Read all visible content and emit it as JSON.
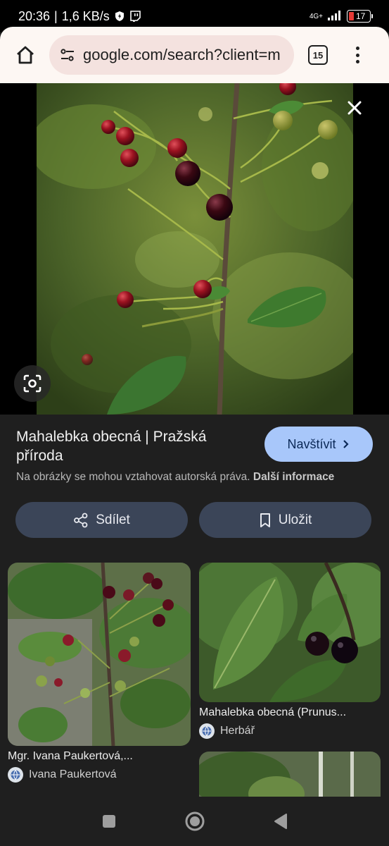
{
  "status": {
    "time": "20:36",
    "speed": "1,6 KB/s",
    "network": "4G+",
    "battery": "17"
  },
  "browser": {
    "url": "google.com/search?client=m",
    "tab_count": "15"
  },
  "result": {
    "title": "Mahalebka obecná | Pražská příroda",
    "visit_label": "Navštívit",
    "copyright_text": "Na obrázky se mohou vztahovat autorská práva.",
    "more_info_label": "Další informace",
    "share_label": "Sdílet",
    "save_label": "Uložit"
  },
  "related": [
    {
      "caption": "Mgr. Ivana Paukertová,...",
      "source": "Ivana Paukertová"
    },
    {
      "caption": "Mahalebka obecná (Prunus...",
      "source": "Herbář"
    }
  ],
  "icons": {
    "home": "home-icon",
    "tune": "tune-icon",
    "menu": "more-vert-icon",
    "close": "close-icon",
    "lens": "lens-icon",
    "share": "share-icon",
    "bookmark": "bookmark-icon",
    "chevron": "chevron-right-icon"
  },
  "colors": {
    "visit_button": "#a8c7fa",
    "action_button": "#3b4558",
    "url_pill": "#f4e2df",
    "battery_low": "#e53935"
  }
}
